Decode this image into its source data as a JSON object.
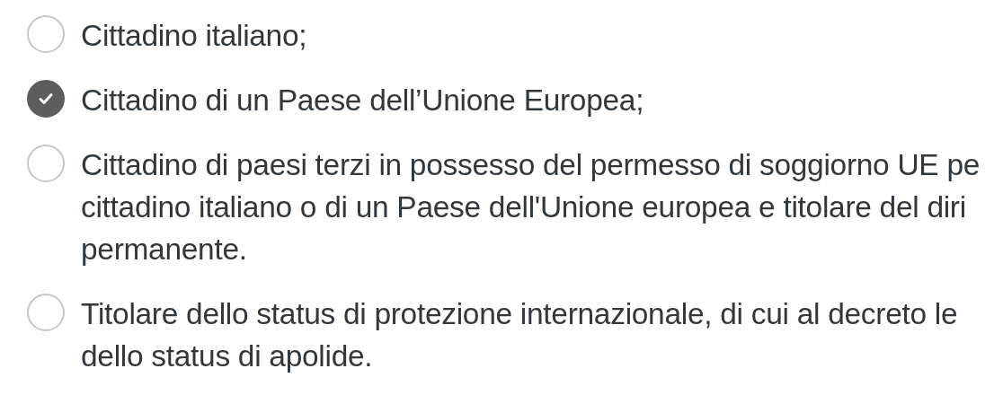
{
  "options": [
    {
      "lines": [
        "Cittadino italiano;"
      ],
      "selected": false
    },
    {
      "lines": [
        "Cittadino di un Paese dell’Unione Europea;"
      ],
      "selected": true
    },
    {
      "lines": [
        "Cittadino di paesi terzi in possesso del permesso di soggiorno UE pe",
        "cittadino italiano o di un Paese dell'Unione europea e titolare del diri",
        "permanente."
      ],
      "selected": false
    },
    {
      "lines": [
        "Titolare dello status di protezione internazionale, di cui al decreto le",
        "dello status di apolide."
      ],
      "selected": false
    }
  ]
}
